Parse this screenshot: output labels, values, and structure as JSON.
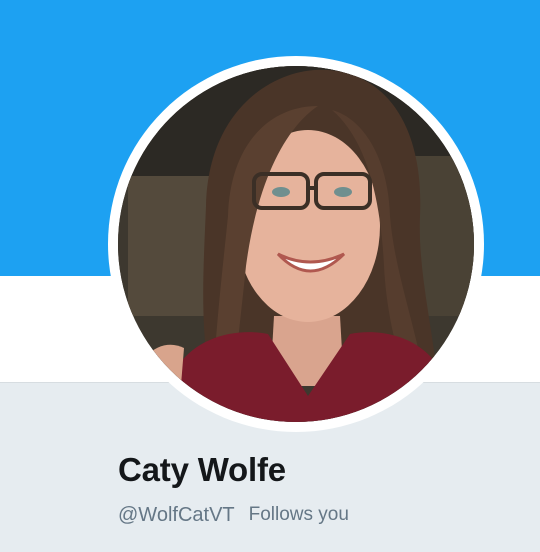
{
  "profile": {
    "display_name": "Caty Wolfe",
    "handle": "@WolfCatVT",
    "follows_you_label": "Follows you",
    "avatar_icon": "profile-photo"
  },
  "colors": {
    "header": "#1da1f2",
    "background": "#e6ecf0",
    "name_text": "#14171a",
    "secondary_text": "#657786"
  }
}
